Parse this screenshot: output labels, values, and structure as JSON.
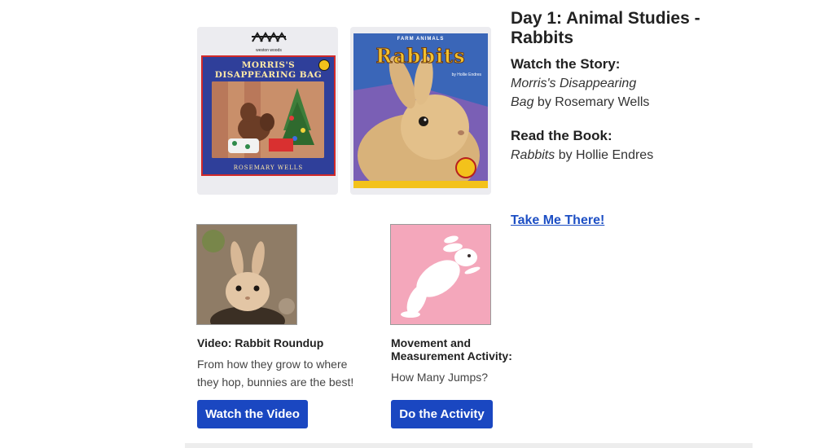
{
  "lesson": {
    "title": "Day 1: Animal Studies - Rabbits",
    "watch_heading": "Watch the Story:",
    "story_title_line1": "Morris's Disappearing",
    "story_title_line2": "Bag",
    "story_author": " by Rosemary Wells",
    "read_heading": "Read the Book:",
    "book_title": "Rabbits",
    "book_author": " by Hollie Endres",
    "link_label": "Take Me There!"
  },
  "covers": {
    "morris": {
      "publisher": "weston woods",
      "title_line1": "MORRIS'S",
      "title_line2": "DISAPPEARING BAG",
      "author": "ROSEMARY WELLS"
    },
    "rabbits": {
      "kicker": "FARM ANIMALS",
      "title": "Rabbits",
      "author": "by Hollie Endres"
    }
  },
  "activities": [
    {
      "title": "Video: Rabbit Roundup",
      "description": "From how they grow to where they hop, bunnies are the best!",
      "button_label": "Watch the Video"
    },
    {
      "title": "Movement and Measurement Activity:",
      "description": "How Many Jumps?",
      "button_label": "Do the Activity"
    }
  ],
  "colors": {
    "link": "#1d4fc4",
    "button": "#1a47c1",
    "activity_thumb_bg": "#f4a7bb"
  },
  "icons": {
    "publisher_logo": "weston-woods-logo-icon",
    "rabbit_photo": "rabbit-photo-icon",
    "jumping_rabbit": "jumping-rabbit-icon"
  }
}
